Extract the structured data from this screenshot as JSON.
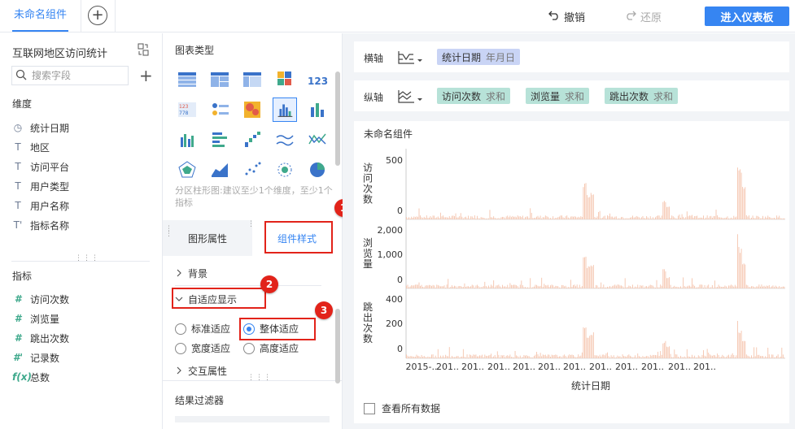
{
  "topbar": {
    "tab_label": "未命名组件",
    "add_tab": "+",
    "undo_label": "撤销",
    "redo_label": "还原",
    "enter_dashboard_label": "进入仪表板"
  },
  "left": {
    "dataset_title": "互联网地区访问统计",
    "search_placeholder": "搜索字段",
    "add_symbol": "+",
    "dimension_label": "维度",
    "dimensions": [
      {
        "icon": "clock-icon",
        "glyph": "◷",
        "label": "统计日期"
      },
      {
        "icon": "text-field-icon",
        "glyph": "T",
        "label": "地区"
      },
      {
        "icon": "text-field-icon",
        "glyph": "T",
        "label": "访问平台"
      },
      {
        "icon": "text-field-icon",
        "glyph": "T",
        "label": "用户类型"
      },
      {
        "icon": "text-field-icon",
        "glyph": "T",
        "label": "用户名称"
      },
      {
        "icon": "text-field-icon",
        "glyph": "T'",
        "label": "指标名称"
      }
    ],
    "measure_label": "指标",
    "measures": [
      {
        "icon": "number-field-icon",
        "glyph": "#",
        "label": "访问次数"
      },
      {
        "icon": "number-field-icon",
        "glyph": "#",
        "label": "浏览量"
      },
      {
        "icon": "number-field-icon",
        "glyph": "#",
        "label": "跳出次数"
      },
      {
        "icon": "number-field-icon",
        "glyph": "#'",
        "label": "记录数"
      },
      {
        "icon": "formula-icon",
        "glyph": "f(x)",
        "label": "总数"
      }
    ]
  },
  "middle": {
    "chart_type_title": "图表类型",
    "chart_type_hint": "分区柱形图:建议至少1个维度，至少1个指标",
    "tabs": [
      "图形属性",
      "组件样式"
    ],
    "active_tab": "组件样式",
    "sections": {
      "background": "背景",
      "adaptive_display": "自适应显示",
      "interaction": "交互属性"
    },
    "adaptive_options": [
      {
        "label": "标准适应",
        "checked": false
      },
      {
        "label": "整体适应",
        "checked": true
      },
      {
        "label": "宽度适应",
        "checked": false
      },
      {
        "label": "高度适应",
        "checked": false
      }
    ],
    "result_filter": "结果过滤器",
    "badges": [
      "1",
      "2",
      "3"
    ]
  },
  "right": {
    "x_axis_label": "横轴",
    "y_axis_label": "纵轴",
    "x_fields": [
      {
        "name": "统计日期",
        "agg": "年月日"
      }
    ],
    "y_fields": [
      {
        "name": "访问次数",
        "agg": "求和"
      },
      {
        "name": "浏览量",
        "agg": "求和"
      },
      {
        "name": "跳出次数",
        "agg": "求和"
      }
    ],
    "component_title": "未命名组件",
    "show_all_data_label": "查看所有数据"
  },
  "chart_data": {
    "type": "bar",
    "title": "",
    "xlabel": "统计日期",
    "x_tick_labels": [
      "2015-..",
      "201..",
      "201..",
      "201..",
      "201..",
      "201..",
      "201..",
      "201..",
      "201..",
      "201..",
      "201..",
      "201.."
    ],
    "bar_color": "#f5c6b0",
    "panels": [
      {
        "ylabel": "访问次数",
        "ticks": [
          "500",
          "0"
        ],
        "ylim": [
          0,
          600
        ],
        "peaks": [
          [
            0.47,
            330
          ],
          [
            0.48,
            220
          ],
          [
            0.49,
            250
          ],
          [
            0.68,
            170
          ],
          [
            0.69,
            120
          ],
          [
            0.875,
            520
          ],
          [
            0.88,
            460
          ],
          [
            0.89,
            300
          ]
        ]
      },
      {
        "ylabel": "浏览量",
        "ticks": [
          "2,000",
          "1,000",
          "0"
        ],
        "ylim": [
          0,
          2200
        ],
        "peaks": [
          [
            0.47,
            1100
          ],
          [
            0.48,
            750
          ],
          [
            0.49,
            850
          ],
          [
            0.68,
            650
          ],
          [
            0.69,
            400
          ],
          [
            0.875,
            2100
          ],
          [
            0.88,
            1400
          ],
          [
            0.89,
            900
          ]
        ]
      },
      {
        "ylabel": "跳出次数",
        "ticks": [
          "400",
          "200",
          "0"
        ],
        "ylim": [
          0,
          420
        ],
        "peaks": [
          [
            0.47,
            220
          ],
          [
            0.48,
            150
          ],
          [
            0.49,
            170
          ],
          [
            0.68,
            110
          ],
          [
            0.69,
            80
          ],
          [
            0.875,
            240
          ],
          [
            0.88,
            180
          ],
          [
            0.89,
            120
          ]
        ]
      }
    ]
  }
}
